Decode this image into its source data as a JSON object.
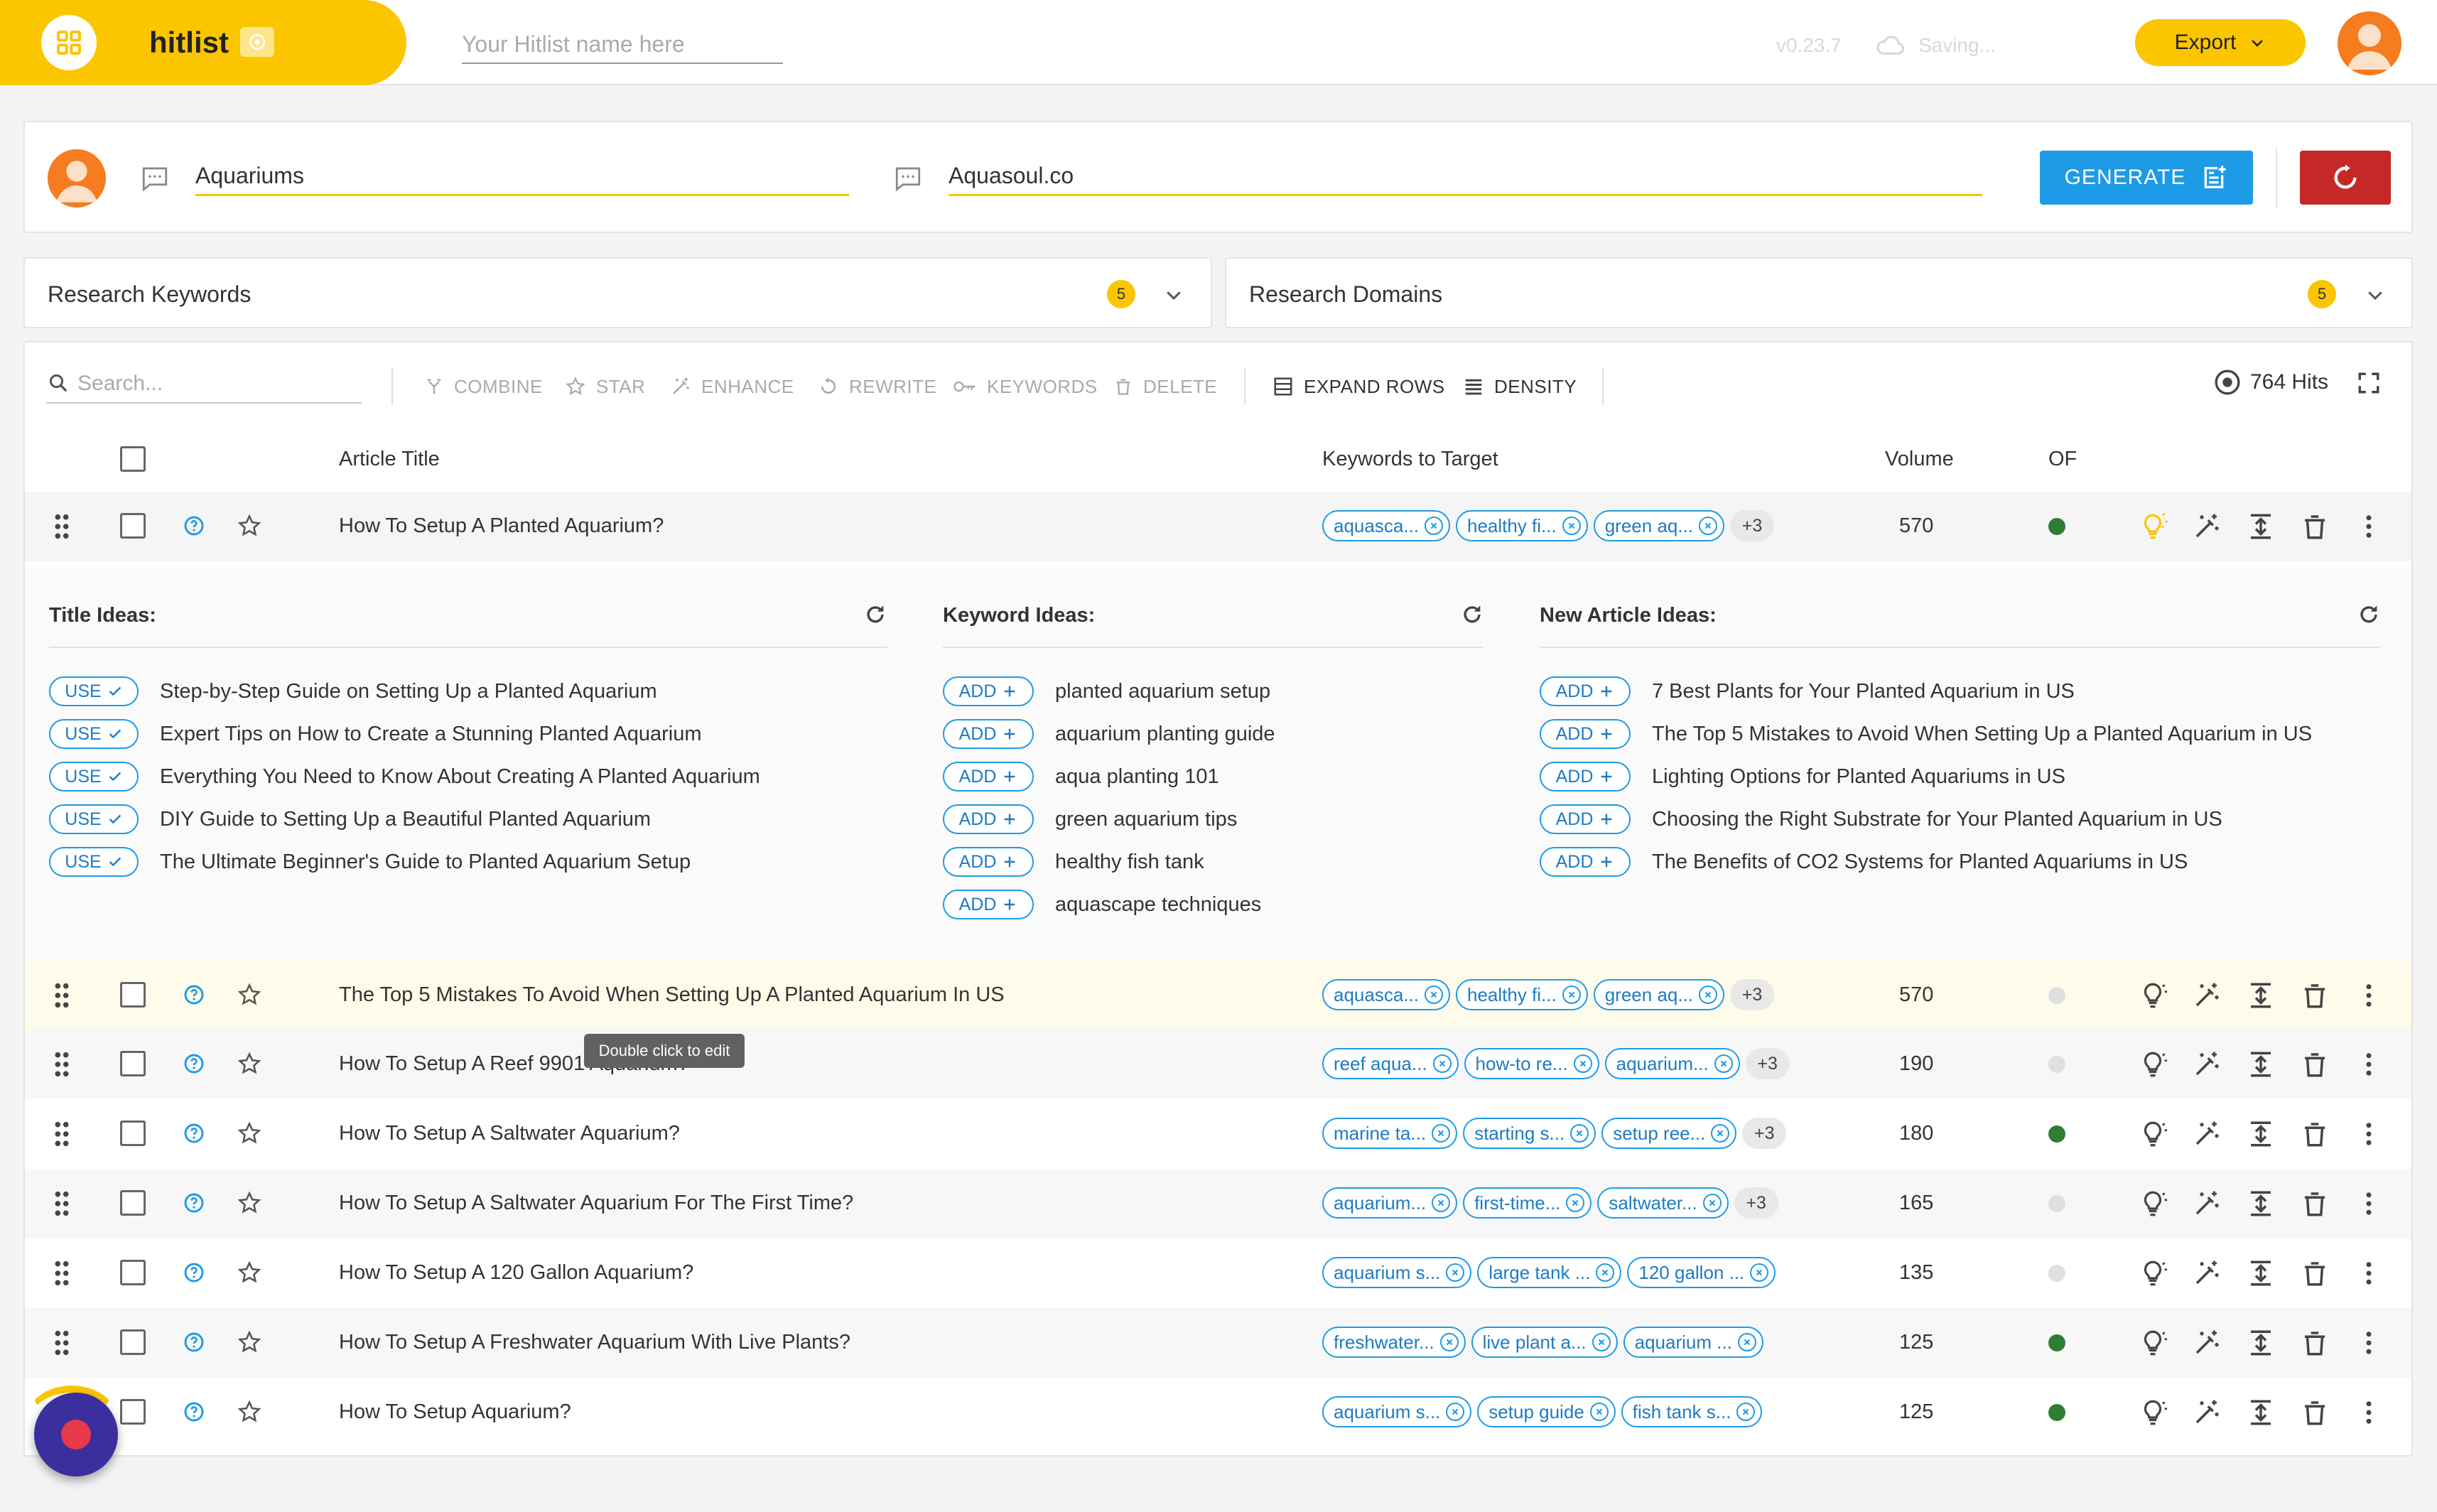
{
  "topbar": {
    "app_name": "hitlist",
    "hitlist_name_placeholder": "Your Hitlist name here",
    "version": "v0.23.7",
    "saving": "Saving...",
    "export_label": "Export"
  },
  "input_panel": {
    "topic": "Aquariums",
    "domain": "Aquasoul.co",
    "generate_label": "GENERATE"
  },
  "research_keywords": {
    "label": "Research Keywords",
    "count": "5"
  },
  "research_domains": {
    "label": "Research Domains",
    "count": "5"
  },
  "toolbar": {
    "search_placeholder": "Search...",
    "combine": "COMBINE",
    "star": "STAR",
    "enhance": "ENHANCE",
    "rewrite": "REWRITE",
    "keywords": "KEYWORDS",
    "delete": "DELETE",
    "expand_rows": "EXPAND ROWS",
    "density": "DENSITY",
    "hits": "764 Hits"
  },
  "columns": {
    "article_title": "Article Title",
    "keywords_to_target": "Keywords to Target",
    "volume": "Volume",
    "of": "OF"
  },
  "rows": [
    {
      "title": "How To Setup A Planted Aquarium?",
      "keywords": [
        "aquasca...",
        "healthy fi...",
        "green aq..."
      ],
      "more": "+3",
      "volume": "570",
      "of_status": "green",
      "highlight": false
    },
    {
      "title": "The Top 5 Mistakes To Avoid When Setting Up A Planted Aquarium In US",
      "keywords": [
        "aquasca...",
        "healthy fi...",
        "green aq..."
      ],
      "more": "+3",
      "volume": "570",
      "of_status": "grey",
      "highlight": true
    },
    {
      "title": "How To Setup A Reef 9901 Aquarium?",
      "keywords": [
        "reef aqua...",
        "how-to re...",
        "aquarium..."
      ],
      "more": "+3",
      "volume": "190",
      "of_status": "grey",
      "highlight": false
    },
    {
      "title": "How To Setup A Saltwater Aquarium?",
      "keywords": [
        "marine ta...",
        "starting s...",
        "setup ree..."
      ],
      "more": "+3",
      "volume": "180",
      "of_status": "green",
      "highlight": false
    },
    {
      "title": "How To Setup A Saltwater Aquarium For The First Time?",
      "keywords": [
        "aquarium...",
        "first-time...",
        "saltwater..."
      ],
      "more": "+3",
      "volume": "165",
      "of_status": "grey",
      "highlight": false
    },
    {
      "title": "How To Setup A 120 Gallon Aquarium?",
      "keywords": [
        "aquarium s...",
        "large tank ...",
        "120 gallon ..."
      ],
      "more": "",
      "volume": "135",
      "of_status": "grey",
      "highlight": false
    },
    {
      "title": "How To Setup A Freshwater Aquarium With Live Plants?",
      "keywords": [
        "freshwater...",
        "live plant a...",
        "aquarium ..."
      ],
      "more": "",
      "volume": "125",
      "of_status": "green",
      "highlight": false
    },
    {
      "title": "How To Setup Aquarium?",
      "keywords": [
        "aquarium s...",
        "setup guide",
        "fish tank s..."
      ],
      "more": "",
      "volume": "125",
      "of_status": "green",
      "highlight": false
    }
  ],
  "expanded": {
    "title_ideas_label": "Title Ideas:",
    "keyword_ideas_label": "Keyword Ideas:",
    "new_article_ideas_label": "New Article Ideas:",
    "use_label": "USE",
    "add_label": "ADD",
    "title_ideas": [
      "Step-by-Step Guide on Setting Up a Planted Aquarium",
      "Expert Tips on How to Create a Stunning Planted Aquarium",
      "Everything You Need to Know About Creating A Planted Aquarium",
      "DIY Guide to Setting Up a Beautiful Planted Aquarium",
      "The Ultimate Beginner's Guide to Planted Aquarium Setup"
    ],
    "keyword_ideas": [
      "planted aquarium setup",
      "aquarium planting guide",
      "aqua planting 101",
      "green aquarium tips",
      "healthy fish tank",
      "aquascape techniques"
    ],
    "new_article_ideas": [
      "7 Best Plants for Your Planted Aquarium in US",
      "The Top 5 Mistakes to Avoid When Setting Up a Planted Aquarium in US",
      "Lighting Options for Planted Aquariums in US",
      "Choosing the Right Substrate for Your Planted Aquarium in US",
      "The Benefits of CO2 Systems for Planted Aquariums in US"
    ]
  },
  "tooltip": "Double click to edit",
  "colors": {
    "brand_yellow": "#fbc500",
    "primary_blue": "#1e9be6",
    "danger_red": "#c62828",
    "status_green": "#2e7d32",
    "status_grey": "#e0e0e0",
    "highlight_row": "#fffbea"
  },
  "icons": {
    "brand": "grid-icon",
    "export": "chevron-down-icon",
    "row_actions": [
      "lightbulb-icon",
      "magic-wand-icon",
      "expand-vertical-icon",
      "trash-icon",
      "more-vert-icon"
    ]
  }
}
